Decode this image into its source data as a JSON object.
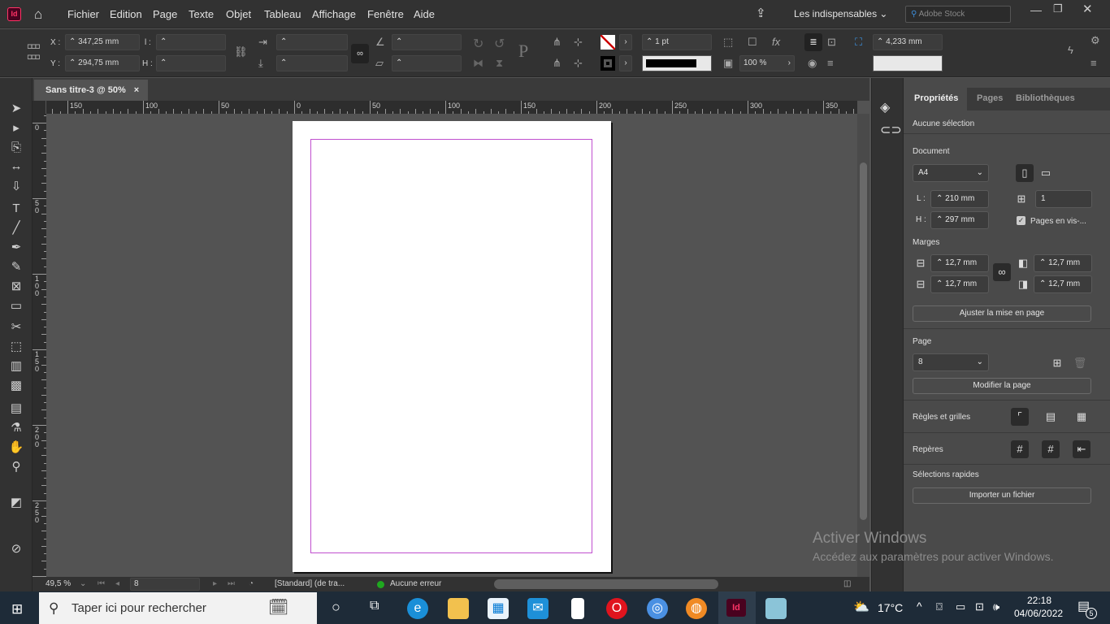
{
  "app": {
    "logo": "Id",
    "workspace": "Les indispensables",
    "stock_placeholder": "Adobe Stock"
  },
  "menu": [
    "Fichier",
    "Edition",
    "Page",
    "Texte",
    "Objet",
    "Tableau",
    "Affichage",
    "Fenêtre",
    "Aide"
  ],
  "control": {
    "x_label": "X :",
    "x_value": "347,25 mm",
    "y_label": "Y :",
    "y_value": "294,75 mm",
    "w_label": "l :",
    "h_label": "H :",
    "stroke_weight": "1 pt",
    "opacity": "100 %",
    "spacing": "4,233 mm"
  },
  "document_tab": {
    "title": "Sans titre-3 @ 50%",
    "close": "×"
  },
  "ruler": {
    "top_labels": [
      "150",
      "100",
      "50",
      "0",
      "50",
      "100",
      "150",
      "200",
      "250",
      "300",
      "350"
    ],
    "left_labels": [
      "0",
      "50",
      "100",
      "150",
      "200",
      "250"
    ]
  },
  "status": {
    "zoom": "49,5 %",
    "page": "8",
    "profile": "[Standard] (de tra...",
    "preflight": "Aucune erreur",
    "preflight_color": "#1fa81f"
  },
  "panel": {
    "tabs": [
      "Propriétés",
      "Pages",
      "Bibliothèques"
    ],
    "no_selection": "Aucune sélection",
    "document": "Document",
    "preset": "A4",
    "w_label": "L :",
    "width": "210 mm",
    "h_label": "H :",
    "height": "297 mm",
    "pages_count": "1",
    "facing_pages": "Pages en vis-...",
    "facing_checked": true,
    "margins": "Marges",
    "margin_top": "12,7 mm",
    "margin_bottom": "12,7 mm",
    "margin_inside": "12,7 mm",
    "margin_outside": "12,7 mm",
    "adjust_layout": "Ajuster la mise en page",
    "page": "Page",
    "page_value": "8",
    "edit_page": "Modifier la page",
    "rulers_grids": "Règles et grilles",
    "guides": "Repères",
    "quick_actions": "Sélections rapides",
    "import_file": "Importer un fichier"
  },
  "watermark": {
    "title": "Activer Windows",
    "subtitle": "Accédez aux paramètres pour activer Windows."
  },
  "taskbar": {
    "search_placeholder": "Taper ici pour rechercher",
    "temperature": "17°C",
    "time": "22:18",
    "date": "04/06/2022",
    "notifications": "5"
  },
  "colors": {
    "accent": "#ff3366",
    "margin_guide": "#c04fcf",
    "taskbar": "#1e2b38"
  }
}
